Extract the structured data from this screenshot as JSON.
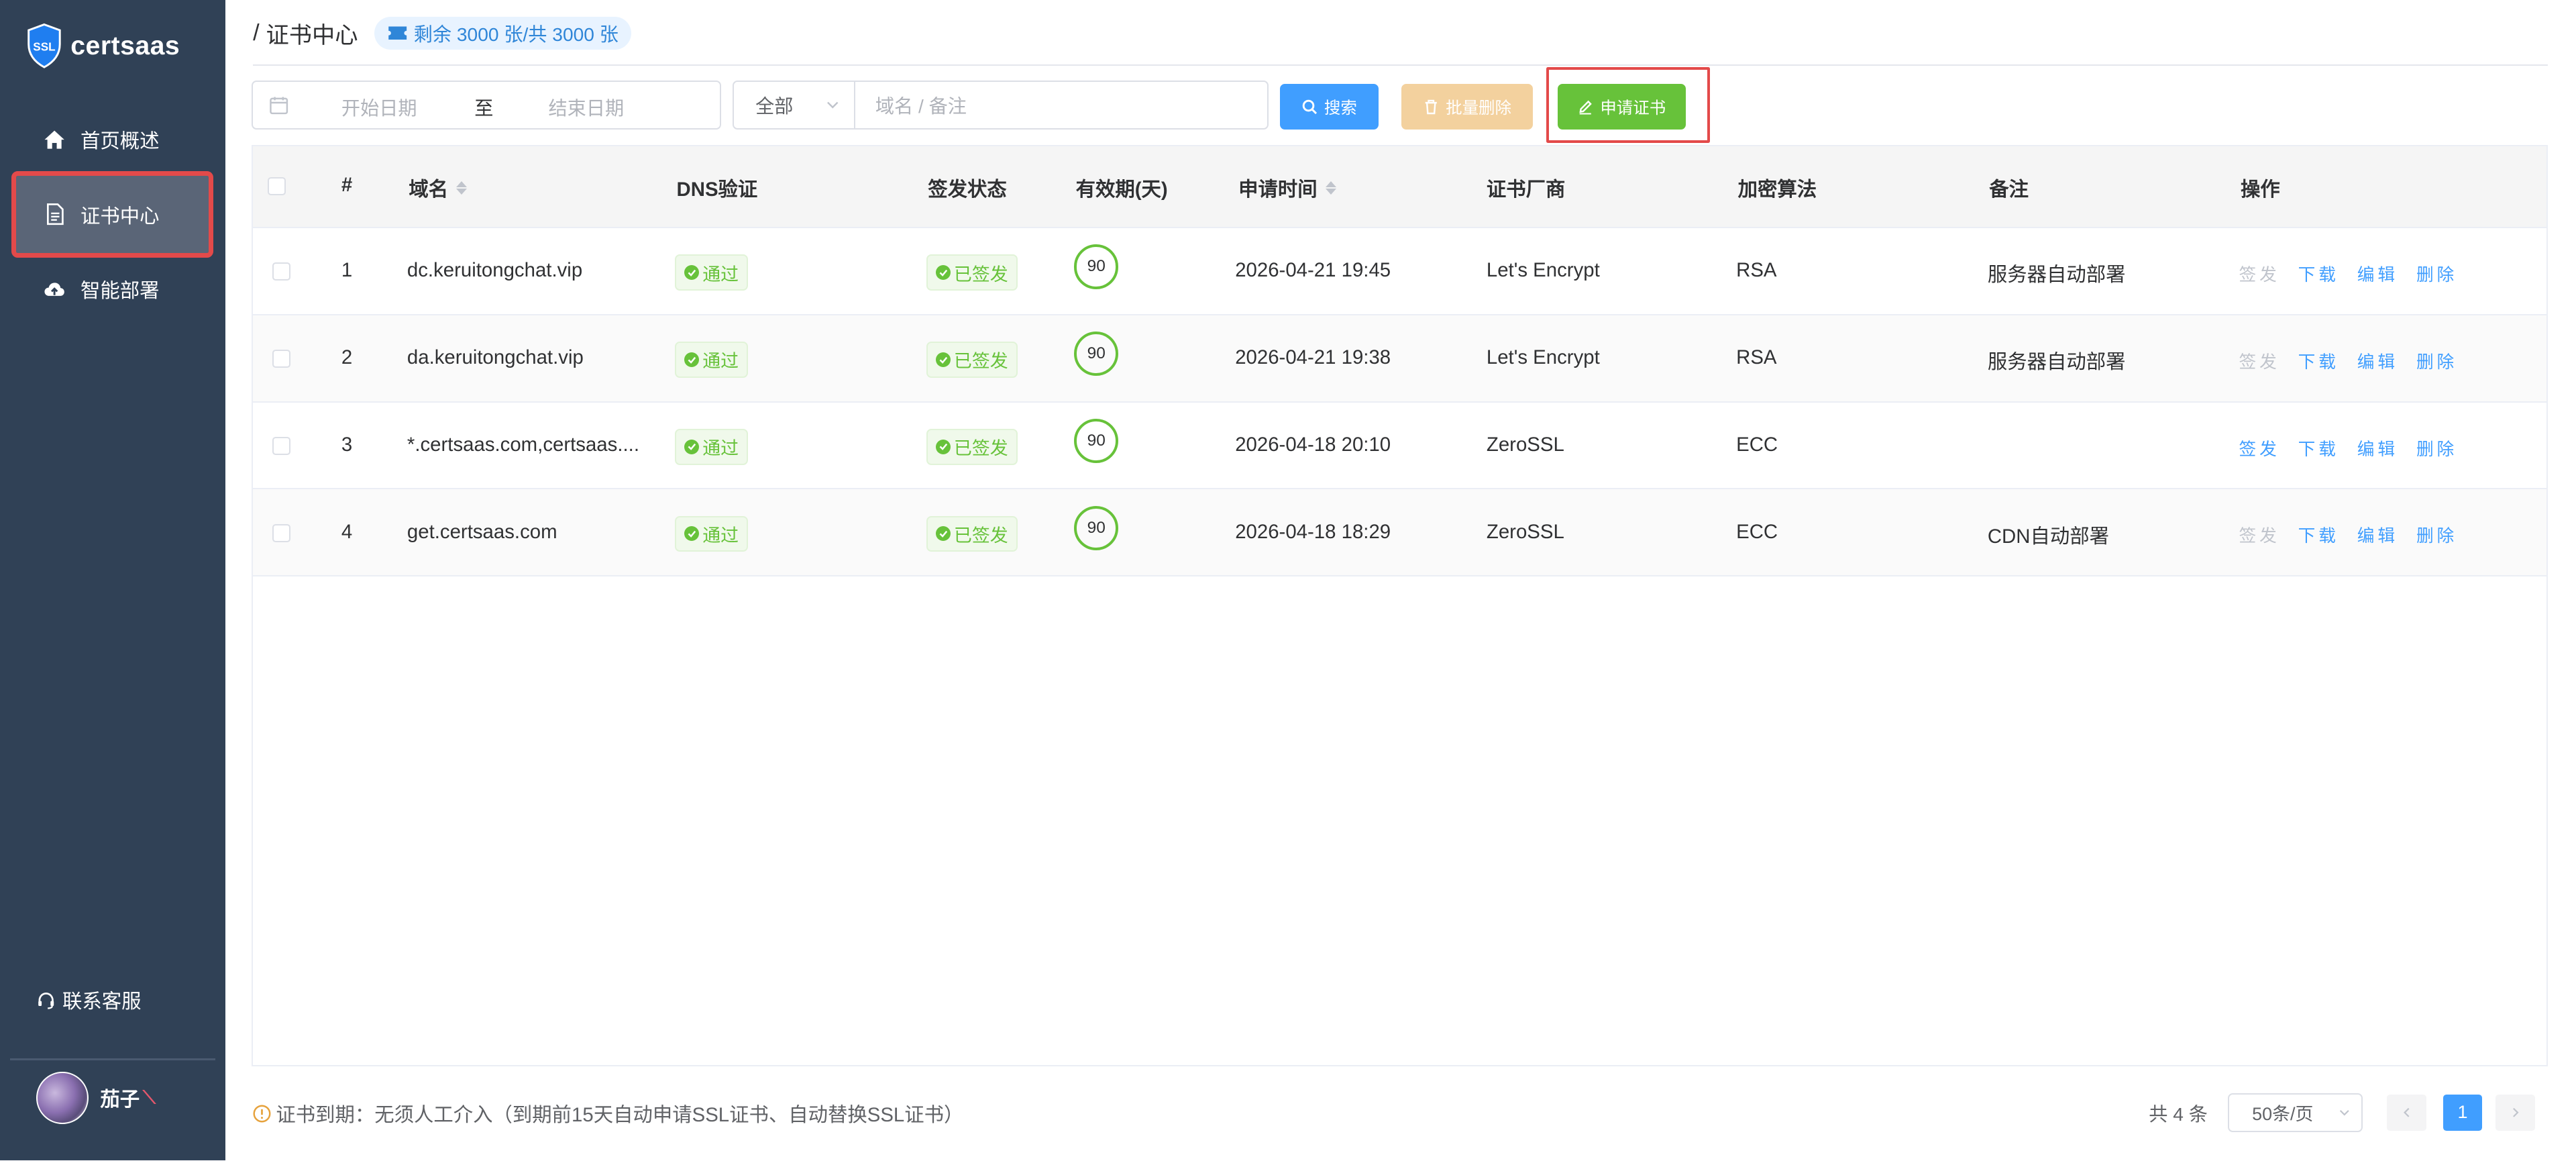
{
  "app": {
    "brand": "certsaas",
    "logo_badge": "SSL"
  },
  "sidebar": {
    "items": [
      {
        "label": "首页概述",
        "icon": "home-icon"
      },
      {
        "label": "证书中心",
        "icon": "document-icon",
        "active": true
      },
      {
        "label": "智能部署",
        "icon": "cloud-upload-icon"
      }
    ],
    "support": "联系客服",
    "user_name": "茄子"
  },
  "header": {
    "breadcrumb_sep": "/",
    "breadcrumb": "证书中心",
    "quota": "剩余 3000 张/共 3000 张"
  },
  "toolbar": {
    "start_placeholder": "开始日期",
    "range_sep": "至",
    "end_placeholder": "结束日期",
    "filter_selected": "全部",
    "search_placeholder": "域名 / 备注",
    "search_label": "搜索",
    "batch_delete_label": "批量删除",
    "apply_label": "申请证书"
  },
  "table": {
    "columns": [
      "#",
      "域名",
      "DNS验证",
      "签发状态",
      "有效期(天)",
      "申请时间",
      "证书厂商",
      "加密算法",
      "备注",
      "操作"
    ],
    "rows": [
      {
        "index": "1",
        "domain": "dc.keruitongchat.vip",
        "dns": "通过",
        "status": "已签发",
        "validity": "90",
        "time": "2026-04-21 19:45",
        "vendor": "Let's Encrypt",
        "algo": "RSA",
        "remark": "服务器自动部署",
        "issue_enabled": false
      },
      {
        "index": "2",
        "domain": "da.keruitongchat.vip",
        "dns": "通过",
        "status": "已签发",
        "validity": "90",
        "time": "2026-04-21 19:38",
        "vendor": "Let's Encrypt",
        "algo": "RSA",
        "remark": "服务器自动部署",
        "issue_enabled": false
      },
      {
        "index": "3",
        "domain": "*.certsaas.com,certsaas....",
        "dns": "通过",
        "status": "已签发",
        "validity": "90",
        "time": "2026-04-18 20:10",
        "vendor": "ZeroSSL",
        "algo": "ECC",
        "remark": "",
        "issue_enabled": true
      },
      {
        "index": "4",
        "domain": "get.certsaas.com",
        "dns": "通过",
        "status": "已签发",
        "validity": "90",
        "time": "2026-04-18 18:29",
        "vendor": "ZeroSSL",
        "algo": "ECC",
        "remark": "CDN自动部署",
        "issue_enabled": false
      }
    ],
    "actions": {
      "issue": "签发",
      "download": "下载",
      "edit": "编辑",
      "delete": "删除"
    }
  },
  "footer": {
    "note": "证书到期：无须人工介入（到期前15天自动申请SSL证书、自动替换SSL证书）",
    "total": "共 4 条",
    "page_size": "50条/页",
    "current_page": "1"
  },
  "colors": {
    "sidebar_bg": "#304156",
    "primary": "#409eff",
    "success": "#67c23a",
    "warning_light": "#f3d19e",
    "highlight_border": "#e34a4a"
  }
}
